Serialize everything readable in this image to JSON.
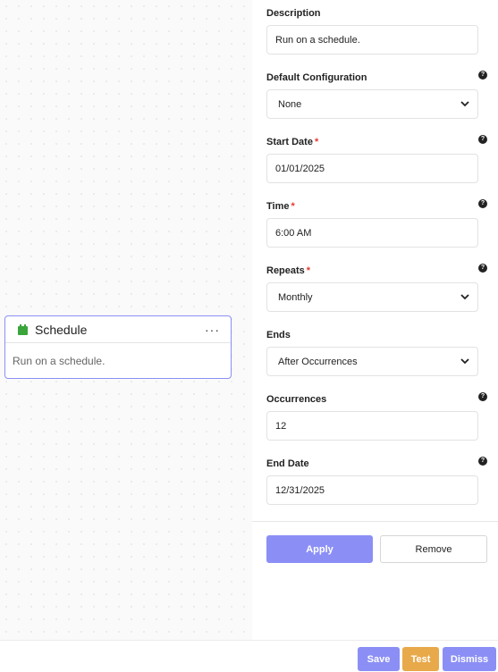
{
  "node": {
    "title": "Schedule",
    "menu": "···",
    "description": "Run on a schedule.",
    "icon": "calendar-icon",
    "icon_color": "#3aa53a"
  },
  "panel": {
    "description": {
      "label": "Description",
      "value": "Run on a schedule."
    },
    "default_configuration": {
      "label": "Default Configuration",
      "value": "None"
    },
    "start_date": {
      "label": "Start Date",
      "required": "*",
      "value": "01/01/2025"
    },
    "time": {
      "label": "Time",
      "required": "*",
      "value": "6:00 AM"
    },
    "repeats": {
      "label": "Repeats",
      "required": "*",
      "value": "Monthly"
    },
    "ends": {
      "label": "Ends",
      "value": "After Occurrences"
    },
    "occurrences": {
      "label": "Occurrences",
      "value": "12"
    },
    "end_date": {
      "label": "End Date",
      "value": "12/31/2025"
    },
    "help_glyph": "?",
    "apply_label": "Apply",
    "remove_label": "Remove"
  },
  "footer": {
    "save_label": "Save",
    "test_label": "Test",
    "dismiss_label": "Dismiss"
  },
  "colors": {
    "accent": "#8b8ff5",
    "test": "#e8a94a",
    "required": "#e53935"
  }
}
